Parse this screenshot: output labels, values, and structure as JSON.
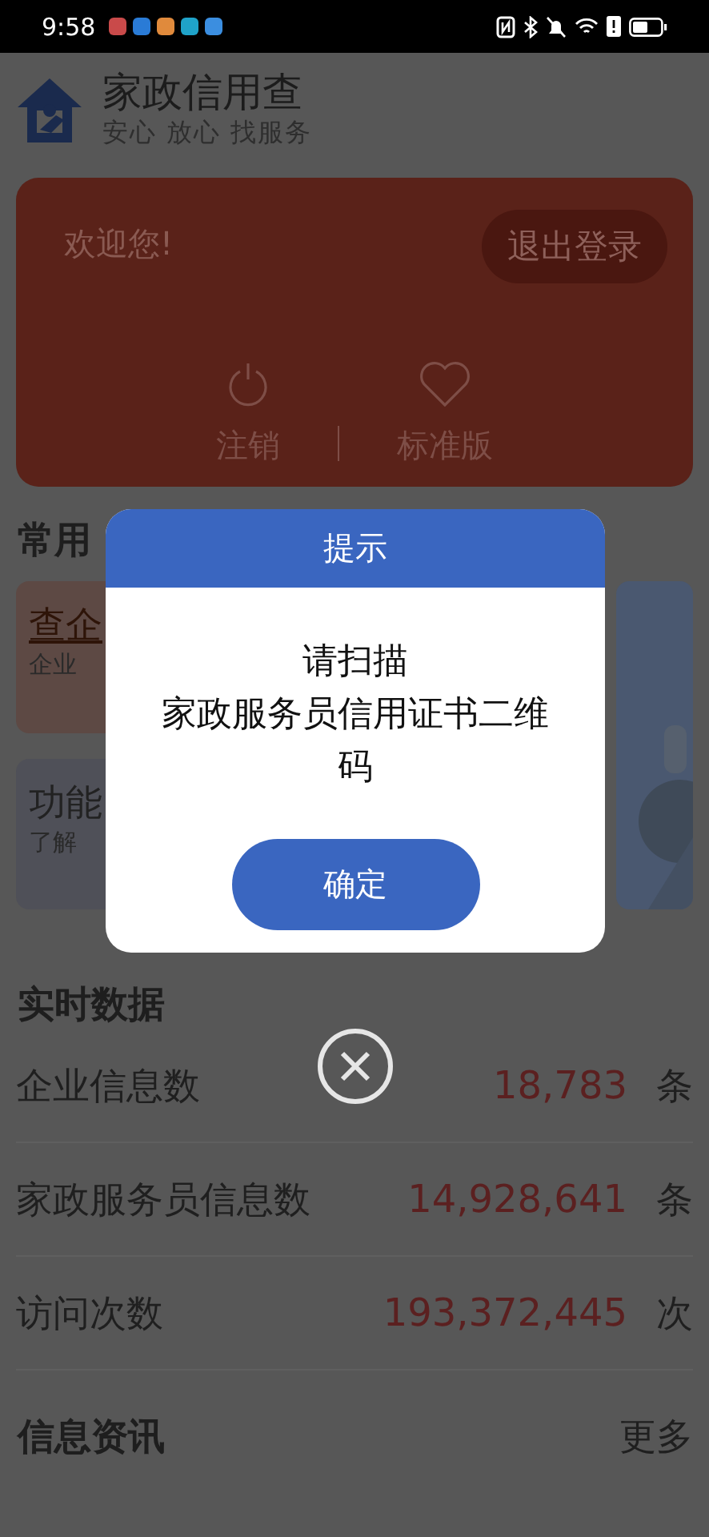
{
  "status_bar": {
    "time": "9:58"
  },
  "header": {
    "title": "家政信用查",
    "subtitle": "安心 放心 找服务"
  },
  "welcome_card": {
    "greeting": "欢迎您!",
    "logout_button": "退出登录",
    "actions": [
      {
        "kind": "power",
        "label": "注销"
      },
      {
        "kind": "heart",
        "label": "标准版"
      }
    ]
  },
  "common": {
    "title": "常用",
    "cards": [
      {
        "kind": "warm",
        "title": "查企",
        "subtitle": "企业"
      },
      {
        "kind": "cool",
        "title": "功能",
        "subtitle": "了解"
      }
    ]
  },
  "dialog": {
    "title": "提示",
    "message_lines": [
      "请扫描",
      "家政服务员信用证书二维码"
    ],
    "confirm_button": "确定"
  },
  "stats": {
    "title": "实时数据",
    "rows": [
      {
        "label": "企业信息数",
        "value": "18,783",
        "unit": "条"
      },
      {
        "label": "家政服务员信息数",
        "value": "14,928,641",
        "unit": "条"
      },
      {
        "label": "访问次数",
        "value": "193,372,445",
        "unit": "次"
      }
    ]
  },
  "news": {
    "title": "信息资讯",
    "more_link": "更多"
  }
}
